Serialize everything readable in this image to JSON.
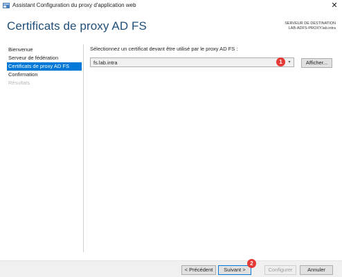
{
  "window": {
    "title": "Assistant Configuration du proxy d'application web",
    "close_glyph": "✕"
  },
  "header": {
    "page_title": "Certificats de proxy AD FS",
    "dest_label": "SERVEUR DE DESTINATION",
    "dest_server": "LAB-ADFS-PROXY.lab.intra"
  },
  "nav": {
    "items": [
      {
        "label": "Bienvenue",
        "state": "normal"
      },
      {
        "label": "Serveur de fédération",
        "state": "normal"
      },
      {
        "label": "Certificats de proxy AD FS",
        "state": "active"
      },
      {
        "label": "Confirmation",
        "state": "normal"
      },
      {
        "label": "Résultats",
        "state": "disabled"
      }
    ]
  },
  "content": {
    "instruction": "Sélectionnez un certificat devant être utilisé par le proxy AD FS :",
    "certificate_selected": "fs.lab.intra",
    "dropdown_arrow": "▾",
    "view_button": "Afficher..."
  },
  "markers": {
    "one": "1",
    "two": "2"
  },
  "footer": {
    "prev_button": "< Précédent",
    "next_button": "Suivant >",
    "configure_button": "Configurer",
    "cancel_button": "Annuler"
  },
  "colors": {
    "accent": "#0078d7",
    "title_blue": "#1f4e79",
    "marker_red": "#e53935"
  }
}
